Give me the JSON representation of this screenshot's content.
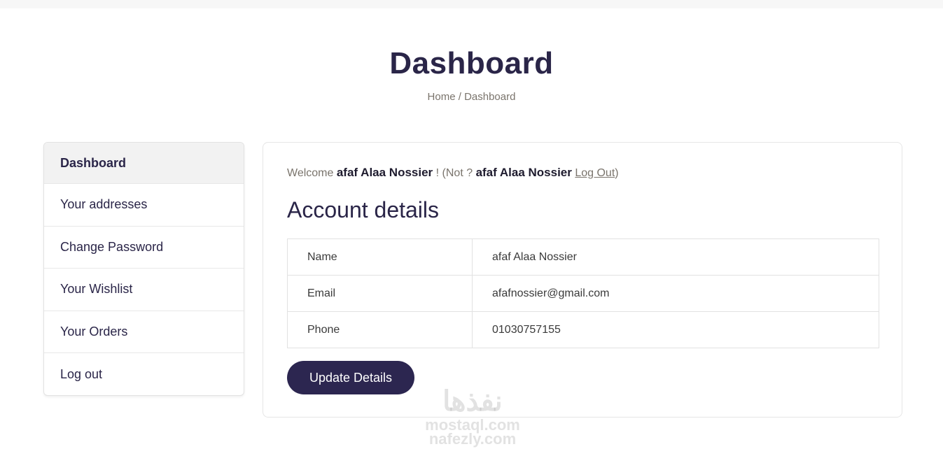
{
  "page": {
    "title": "Dashboard",
    "breadcrumb": {
      "home": "Home",
      "separator": "/",
      "current": "Dashboard"
    }
  },
  "sidebar": {
    "items": [
      {
        "label": "Dashboard",
        "active": true
      },
      {
        "label": "Your addresses"
      },
      {
        "label": "Change Password"
      },
      {
        "label": "Your Wishlist"
      },
      {
        "label": "Your Orders"
      },
      {
        "label": "Log out"
      }
    ]
  },
  "welcome": {
    "prefix": "Welcome",
    "name": "afaf Alaa Nossier",
    "exclaim": "!",
    "not_prefix": "(Not ?",
    "not_name": "afaf Alaa Nossier",
    "logout_link": "Log Out",
    "close_paren": ")"
  },
  "account": {
    "title": "Account details",
    "rows": [
      {
        "key": "Name",
        "value": "afaf Alaa Nossier"
      },
      {
        "key": "Email",
        "value": "afafnossier@gmail.com"
      },
      {
        "key": "Phone",
        "value": "01030757155"
      }
    ],
    "update_label": "Update Details"
  },
  "watermark": {
    "logo": "نفذها",
    "line1": "mostaql.com",
    "line2": "nafezly.com"
  },
  "colors": {
    "primary": "#2c2650",
    "muted_text": "#7a746c",
    "active_bg": "#f2f2f2"
  }
}
